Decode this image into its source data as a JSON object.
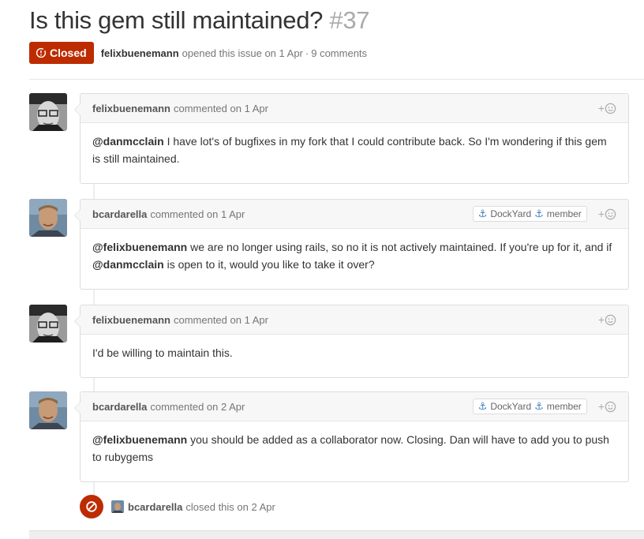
{
  "issue": {
    "title": "Is this gem still maintained?",
    "number": "#37",
    "state_label": "Closed",
    "author": "felixbuenemann",
    "opened_text": "opened this issue on 1 Apr",
    "separator": "·",
    "comments_count": "9 comments"
  },
  "colors": {
    "closed": "#bd2c00",
    "link": "#4183c4"
  },
  "comments": [
    {
      "author": "felixbuenemann",
      "action": "commented on 1 Apr",
      "badges": [],
      "body": {
        "mention1": "@danmcclain",
        "text1": " I have lot's of bugfixes in my fork that I could contribute back. So I'm wondering if this gem is still maintained."
      }
    },
    {
      "author": "bcardarella",
      "action": "commented on 1 Apr",
      "badges": [
        "DockYard",
        "member"
      ],
      "body": {
        "mention1": "@felixbuenemann",
        "text1": " we are no longer using rails, so no it is not actively maintained. If you're up for it, and if ",
        "mention2": "@danmcclain",
        "text2": " is open to it, would you like to take it over?"
      }
    },
    {
      "author": "felixbuenemann",
      "action": "commented on 1 Apr",
      "badges": [],
      "body": {
        "text1": "I'd be willing to maintain this."
      }
    },
    {
      "author": "bcardarella",
      "action": "commented on 2 Apr",
      "badges": [
        "DockYard",
        "member"
      ],
      "body": {
        "mention1": "@felixbuenemann",
        "text1": " you should be added as a collaborator now. Closing. Dan will have to add you to push to rubygems"
      }
    }
  ],
  "close_event": {
    "actor": "bcardarella",
    "text": "closed this on 2 Apr"
  },
  "icons": {
    "state": "issue-closed-icon",
    "reaction": "add-reaction-smiley-icon",
    "badge": "anchor-icon",
    "event": "circle-slash-icon"
  }
}
